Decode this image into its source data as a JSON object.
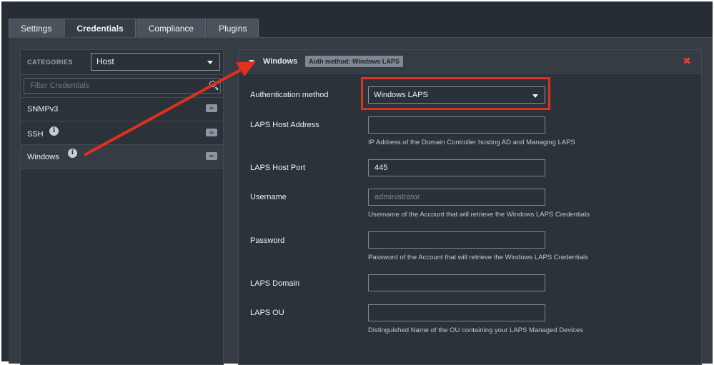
{
  "tabs": [
    {
      "label": "Settings"
    },
    {
      "label": "Credentials"
    },
    {
      "label": "Compliance"
    },
    {
      "label": "Plugins"
    }
  ],
  "active_tab": "Credentials",
  "sidebar": {
    "categories_label": "CATEGORIES",
    "category_select_value": "Host",
    "filter_placeholder": "Filter Credentials",
    "items": [
      {
        "label": "SNMPv3",
        "info": false,
        "badge": "∞"
      },
      {
        "label": "SSH",
        "info": true,
        "badge": "∞"
      },
      {
        "label": "Windows",
        "info": true,
        "badge": "∞"
      }
    ],
    "info_glyph": "i"
  },
  "panel": {
    "title": "Windows",
    "auth_badge": "Auth method: Windows LAPS",
    "close_glyph": "✖",
    "fields": [
      {
        "label": "Authentication method",
        "type": "select",
        "value": "Windows LAPS"
      },
      {
        "label": "LAPS Host Address",
        "value": "",
        "help": "IP Address of the Domain Controller hosting AD and Managing LAPS"
      },
      {
        "label": "LAPS Host Port",
        "value": "445"
      },
      {
        "label": "Username",
        "value": "",
        "placeholder": "administrator",
        "help": "Username of the Account that will retrieve the Windows LAPS Credentials"
      },
      {
        "label": "Password",
        "value": "",
        "help": "Password of the Account that will retrieve the Windows LAPS Credentials"
      },
      {
        "label": "LAPS Domain",
        "value": ""
      },
      {
        "label": "LAPS OU",
        "value": "",
        "help": "Distinguished Name of the OU containing your LAPS Managed Devices"
      }
    ]
  },
  "annotation_color": "#e0301e"
}
